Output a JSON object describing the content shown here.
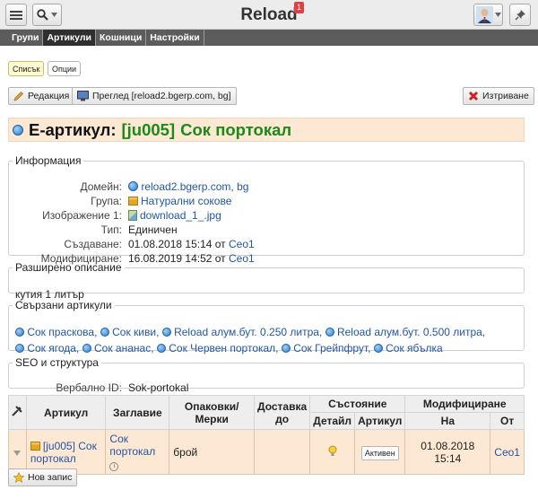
{
  "app": {
    "title": "Reload",
    "notification_count": "1"
  },
  "nav": {
    "tabs": [
      "Групи",
      "Артикули",
      "Кошници",
      "Настройки"
    ],
    "active": 1
  },
  "view": {
    "list_label": "Списък",
    "options_label": "Опции"
  },
  "actions": {
    "edit_label": "Редакция",
    "preview_label": "Преглед [reload2.bgerp.com, bg]",
    "delete_label": "Изтриване"
  },
  "article": {
    "prefix": "Е-артикул:",
    "code": "[ju005]",
    "name": "Сок портокал"
  },
  "info": {
    "legend": "Информация",
    "fields": [
      {
        "label": "Домейн:",
        "value": "reload2.bgerp.com, bg",
        "link": true,
        "icon": "globe-icon"
      },
      {
        "label": "Група:",
        "value": "Натурални сокове",
        "link": true,
        "icon": "folder-icon"
      },
      {
        "label": "Изображение 1:",
        "value": "download_1_.jpg",
        "link": true,
        "icon": "image-icon"
      },
      {
        "label": "Тип:",
        "value": "Единичен",
        "link": false
      },
      {
        "label": "Създаване:",
        "value": "01.08.2018 15:14 от",
        "user": "Ceo1"
      },
      {
        "label": "Модифициране:",
        "value": "16.08.2019 14:52 от",
        "user": "Ceo1"
      }
    ]
  },
  "extended": {
    "legend": "Разширено описание",
    "text": "кутия 1 литър"
  },
  "related": {
    "legend": "Свързани артикули",
    "items": [
      "Сок праскова,",
      "Сок киви,",
      "Reload алум.бут. 0.250 литра,",
      "Reload алум.бут. 0.500 литра,",
      "Сок ягода,",
      "Сок ананас,",
      "Сок Червен портокал,",
      "Сок Грейпфрут,",
      "Сок ябълка"
    ]
  },
  "seo": {
    "legend": "SEO и структура",
    "label": "Вербално ID:",
    "value": "Sok-portokal"
  },
  "table": {
    "headers": {
      "article": "Артикул",
      "title": "Заглавие",
      "packaging": "Опаковки/Мерки",
      "delivery": "Доставка до",
      "state": "Състояние",
      "state_detail": "Детайл",
      "state_article": "Артикул",
      "modified": "Модифициране",
      "modified_on": "На",
      "modified_by": "От"
    },
    "row": {
      "article": "[ju005] Сок портокал",
      "title": "Сок портокал",
      "packaging": "брой",
      "delivery": "",
      "status": "Активен",
      "modified_on": "01.08.2018 15:14",
      "modified_by": "Ceo1"
    }
  },
  "footer": {
    "new_label": "Нов запис"
  },
  "colors": {
    "accent_bg": "#fde8d3",
    "link": "#2255a5",
    "code": "#1a8a1a"
  }
}
